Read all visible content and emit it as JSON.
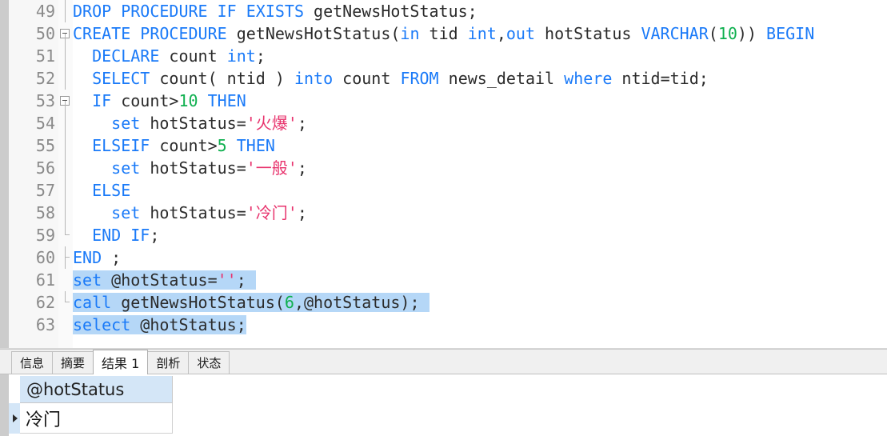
{
  "editor": {
    "first_line_number": 49,
    "lines": [
      {
        "number": "49",
        "fold": "line",
        "selected": false,
        "tokens": [
          {
            "t": "DROP PROCEDURE IF EXISTS",
            "c": "kw"
          },
          {
            "t": " getNewsHotStatus;",
            "c": "plain"
          }
        ]
      },
      {
        "number": "50",
        "fold": "box",
        "selected": false,
        "tokens": [
          {
            "t": "CREATE PROCEDURE",
            "c": "kw"
          },
          {
            "t": " getNewsHotStatus(",
            "c": "plain"
          },
          {
            "t": "in",
            "c": "kw"
          },
          {
            "t": " tid ",
            "c": "plain"
          },
          {
            "t": "int",
            "c": "kw"
          },
          {
            "t": ",",
            "c": "plain"
          },
          {
            "t": "out",
            "c": "kw"
          },
          {
            "t": " hotStatus ",
            "c": "plain"
          },
          {
            "t": "VARCHAR",
            "c": "kw"
          },
          {
            "t": "(",
            "c": "plain"
          },
          {
            "t": "10",
            "c": "num"
          },
          {
            "t": ")) ",
            "c": "plain"
          },
          {
            "t": "BEGIN",
            "c": "kw"
          }
        ]
      },
      {
        "number": "51",
        "fold": "line",
        "selected": false,
        "tokens": [
          {
            "t": "  ",
            "c": "plain"
          },
          {
            "t": "DECLARE",
            "c": "kw"
          },
          {
            "t": " count ",
            "c": "plain"
          },
          {
            "t": "int",
            "c": "kw"
          },
          {
            "t": ";",
            "c": "plain"
          }
        ]
      },
      {
        "number": "52",
        "fold": "line",
        "selected": false,
        "tokens": [
          {
            "t": "  ",
            "c": "plain"
          },
          {
            "t": "SELECT",
            "c": "kw"
          },
          {
            "t": " count( ntid ) ",
            "c": "plain"
          },
          {
            "t": "into",
            "c": "kw"
          },
          {
            "t": " count ",
            "c": "plain"
          },
          {
            "t": "FROM",
            "c": "kw"
          },
          {
            "t": " news_detail ",
            "c": "plain"
          },
          {
            "t": "where",
            "c": "kw"
          },
          {
            "t": " ntid=tid;",
            "c": "plain"
          }
        ]
      },
      {
        "number": "53",
        "fold": "box",
        "selected": false,
        "tokens": [
          {
            "t": "  ",
            "c": "plain"
          },
          {
            "t": "IF",
            "c": "kw"
          },
          {
            "t": " count>",
            "c": "plain"
          },
          {
            "t": "10",
            "c": "num"
          },
          {
            "t": " ",
            "c": "plain"
          },
          {
            "t": "THEN",
            "c": "kw"
          }
        ]
      },
      {
        "number": "54",
        "fold": "line",
        "selected": false,
        "tokens": [
          {
            "t": "    ",
            "c": "plain"
          },
          {
            "t": "set",
            "c": "kw"
          },
          {
            "t": " hotStatus=",
            "c": "plain"
          },
          {
            "t": "'火爆'",
            "c": "str"
          },
          {
            "t": ";",
            "c": "plain"
          }
        ]
      },
      {
        "number": "55",
        "fold": "line",
        "selected": false,
        "tokens": [
          {
            "t": "  ",
            "c": "plain"
          },
          {
            "t": "ELSEIF",
            "c": "kw"
          },
          {
            "t": " count>",
            "c": "plain"
          },
          {
            "t": "5",
            "c": "num"
          },
          {
            "t": " ",
            "c": "plain"
          },
          {
            "t": "THEN",
            "c": "kw"
          }
        ]
      },
      {
        "number": "56",
        "fold": "line",
        "selected": false,
        "tokens": [
          {
            "t": "    ",
            "c": "plain"
          },
          {
            "t": "set",
            "c": "kw"
          },
          {
            "t": " hotStatus=",
            "c": "plain"
          },
          {
            "t": "'一般'",
            "c": "str"
          },
          {
            "t": ";",
            "c": "plain"
          }
        ]
      },
      {
        "number": "57",
        "fold": "line",
        "selected": false,
        "tokens": [
          {
            "t": "  ",
            "c": "plain"
          },
          {
            "t": "ELSE",
            "c": "kw"
          }
        ]
      },
      {
        "number": "58",
        "fold": "line",
        "selected": false,
        "tokens": [
          {
            "t": "    ",
            "c": "plain"
          },
          {
            "t": "set",
            "c": "kw"
          },
          {
            "t": " hotStatus=",
            "c": "plain"
          },
          {
            "t": "'冷门'",
            "c": "str"
          },
          {
            "t": ";",
            "c": "plain"
          }
        ]
      },
      {
        "number": "59",
        "fold": "end",
        "selected": false,
        "tokens": [
          {
            "t": "  ",
            "c": "plain"
          },
          {
            "t": "END IF",
            "c": "kw"
          },
          {
            "t": ";",
            "c": "plain"
          }
        ]
      },
      {
        "number": "60",
        "fold": "end2",
        "selected": false,
        "tokens": [
          {
            "t": "END",
            "c": "kw"
          },
          {
            "t": " ;",
            "c": "plain"
          }
        ]
      },
      {
        "number": "61",
        "fold": "none",
        "selected": true,
        "tokens": [
          {
            "t": "set",
            "c": "kw"
          },
          {
            "t": " @hotStatus=",
            "c": "plain"
          },
          {
            "t": "''",
            "c": "str"
          },
          {
            "t": "; ",
            "c": "plain"
          }
        ]
      },
      {
        "number": "62",
        "fold": "tail",
        "selected": true,
        "tokens": [
          {
            "t": "call",
            "c": "kw"
          },
          {
            "t": " getNewsHotStatus(",
            "c": "plain"
          },
          {
            "t": "6",
            "c": "num"
          },
          {
            "t": ",@hotStatus); ",
            "c": "plain"
          }
        ]
      },
      {
        "number": "63",
        "fold": "none",
        "selected": true,
        "tokens": [
          {
            "t": "select",
            "c": "kw"
          },
          {
            "t": " @hotStatus;",
            "c": "plain"
          }
        ]
      }
    ]
  },
  "result_panel": {
    "tabs": [
      {
        "label": "信息",
        "active": false
      },
      {
        "label": "摘要",
        "active": false
      },
      {
        "label": "结果 1",
        "active": true
      },
      {
        "label": "剖析",
        "active": false
      },
      {
        "label": "状态",
        "active": false
      }
    ],
    "grid": {
      "columns": [
        "@hotStatus"
      ],
      "rows": [
        {
          "indicator": "▶",
          "values": [
            "冷门"
          ]
        }
      ]
    }
  },
  "colors": {
    "keyword": "#1a7af8",
    "number": "#10b050",
    "string": "#e8336d",
    "plain_text": "#2b2b2b",
    "selection": "#b5d7f7",
    "grid_header": "#d4e6f7",
    "gutter_text": "#8a8a8a",
    "marker_strip": "#cccccc"
  }
}
